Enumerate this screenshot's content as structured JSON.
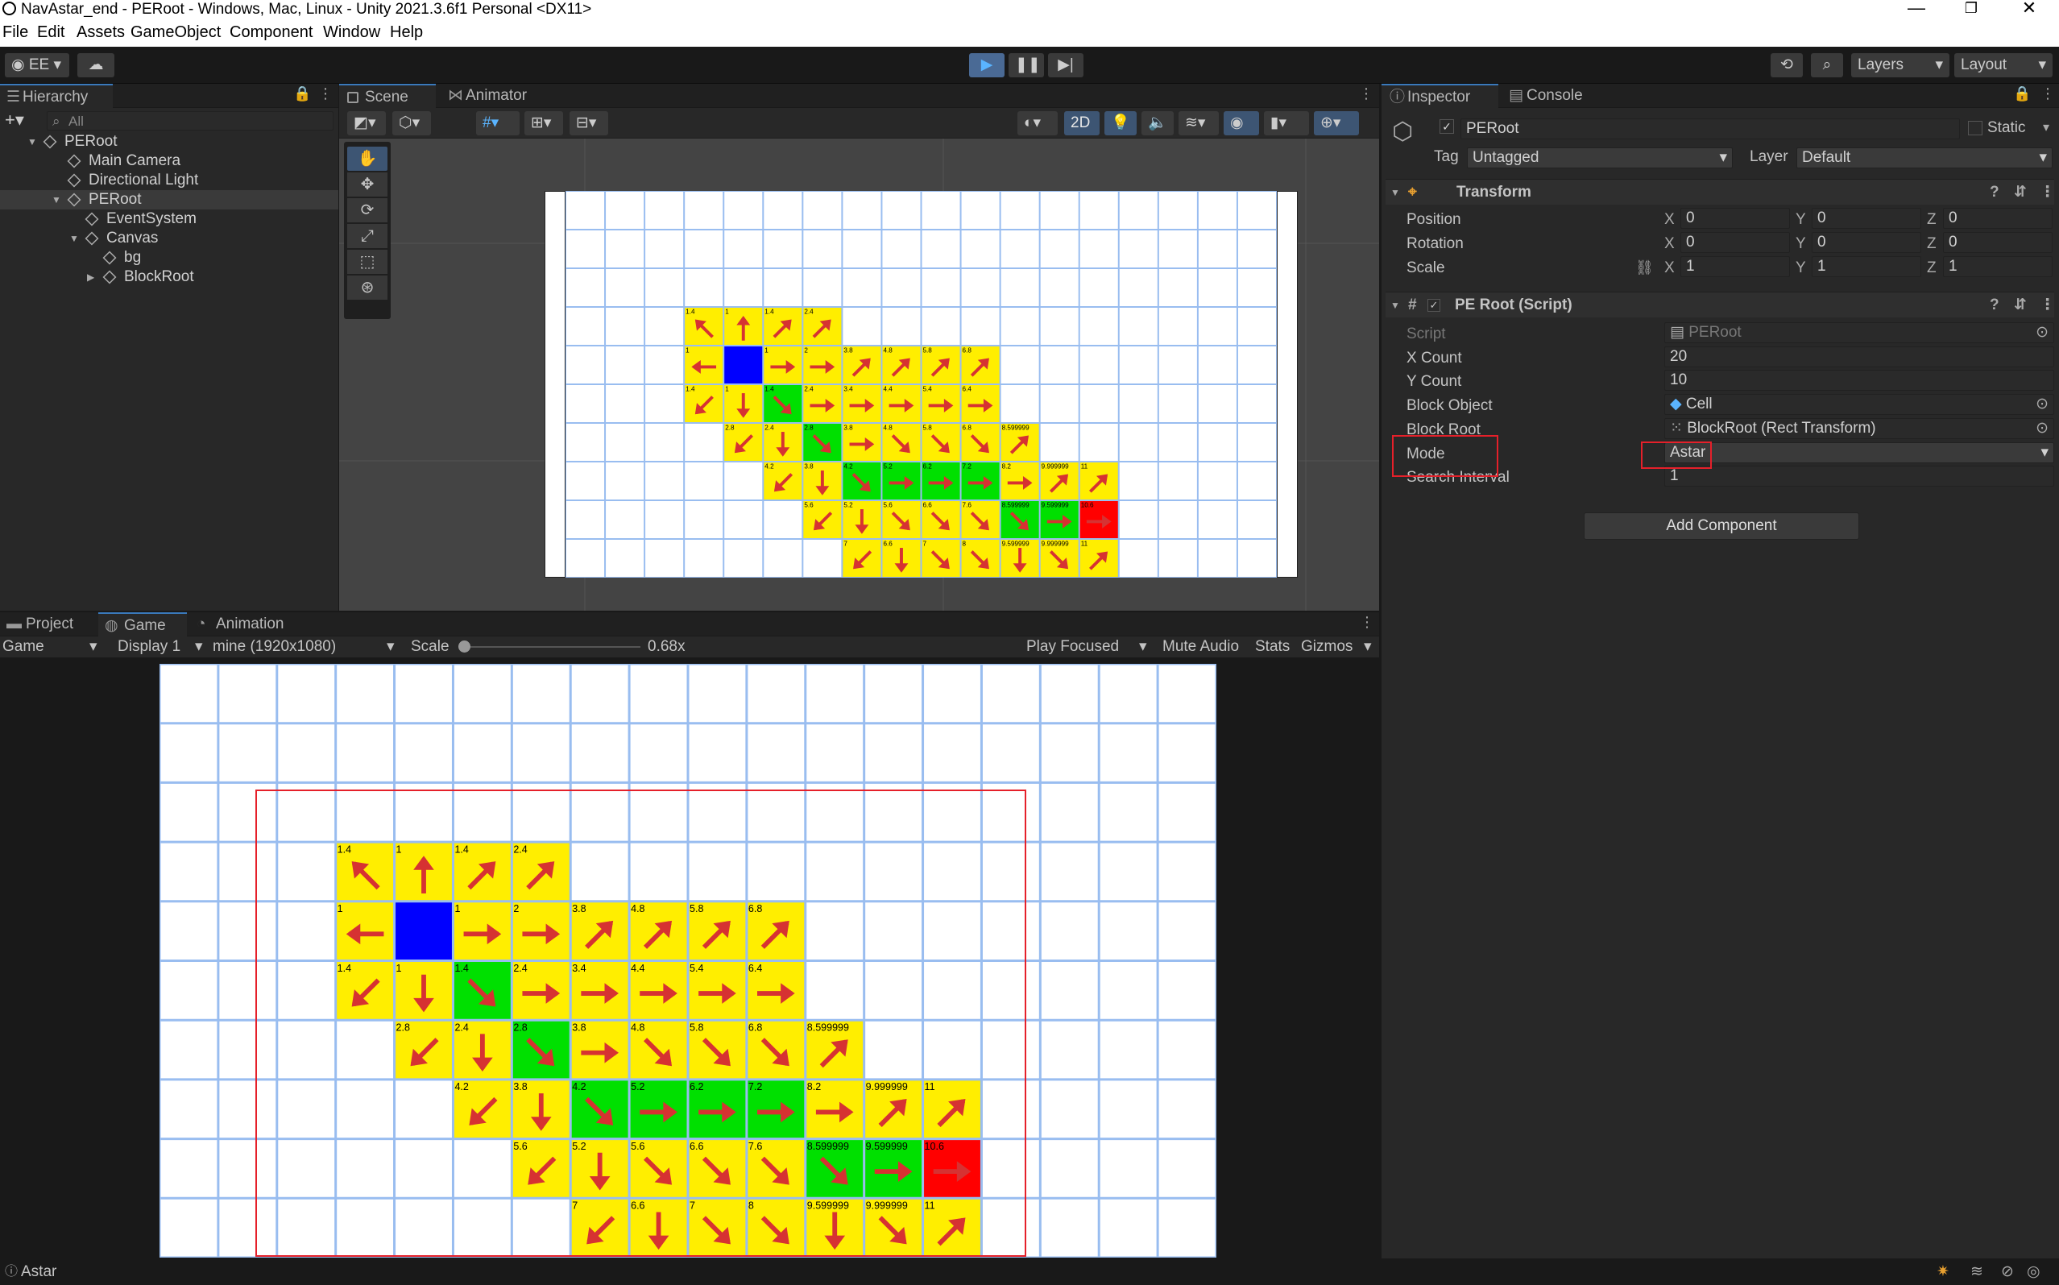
{
  "window": {
    "title": "NavAstar_end - PERoot - Windows, Mac, Linux - Unity 2021.3.6f1 Personal <DX11>",
    "minimize": "—",
    "maximize": "❐",
    "close": "✕"
  },
  "menu": [
    "File",
    "Edit",
    "Assets",
    "GameObject",
    "Component",
    "Window",
    "Help"
  ],
  "toolbar": {
    "account": "EE",
    "layers": "Layers",
    "layout": "Layout"
  },
  "hierarchy": {
    "tab": "Hierarchy",
    "search_placeholder": "All",
    "items": [
      {
        "label": "PERoot",
        "depth": 0
      },
      {
        "label": "Main Camera",
        "depth": 1
      },
      {
        "label": "Directional Light",
        "depth": 1
      },
      {
        "label": "PERoot",
        "depth": 1
      },
      {
        "label": "EventSystem",
        "depth": 2
      },
      {
        "label": "Canvas",
        "depth": 2
      },
      {
        "label": "bg",
        "depth": 3
      },
      {
        "label": "BlockRoot",
        "depth": 3
      }
    ]
  },
  "scene": {
    "tabs": [
      "Scene",
      "Animator"
    ],
    "mode2d": "2D"
  },
  "game": {
    "tabs": [
      "Project",
      "Game",
      "Animation"
    ],
    "display_mode": "Game",
    "display": "Display 1",
    "resolution": "mine (1920x1080)",
    "scale_label": "Scale",
    "scale_value": "0.68x",
    "play_focused": "Play Focused",
    "mute": "Mute Audio",
    "stats": "Stats",
    "gizmos": "Gizmos"
  },
  "inspector": {
    "tabs": [
      "Inspector",
      "Console"
    ],
    "object_name": "PERoot",
    "static_label": "Static",
    "tag_label": "Tag",
    "tag_value": "Untagged",
    "layer_label": "Layer",
    "layer_value": "Default",
    "transform": {
      "title": "Transform",
      "rows": [
        {
          "label": "Position",
          "x": "0",
          "y": "0",
          "z": "0"
        },
        {
          "label": "Rotation",
          "x": "0",
          "y": "0",
          "z": "0"
        },
        {
          "label": "Scale",
          "x": "1",
          "y": "1",
          "z": "1"
        }
      ]
    },
    "script": {
      "title": "PE Root (Script)",
      "fields": [
        {
          "label": "Script",
          "value": "PERoot"
        },
        {
          "label": "X Count",
          "value": "20"
        },
        {
          "label": "Y Count",
          "value": "10"
        },
        {
          "label": "Block Object",
          "value": "Cell"
        },
        {
          "label": "Block Root",
          "value": "BlockRoot (Rect Transform)"
        },
        {
          "label": "Mode",
          "value": "Astar"
        },
        {
          "label": "Search Interval",
          "value": "1"
        }
      ]
    },
    "add_component": "Add Component"
  },
  "status": {
    "text": "Astar"
  },
  "grid": {
    "cols": 18,
    "rows": 10,
    "cells": [
      {
        "r": 3,
        "c": 3,
        "t": "y",
        "v": "1.4",
        "a": "nw"
      },
      {
        "r": 3,
        "c": 4,
        "t": "y",
        "v": "1",
        "a": "n"
      },
      {
        "r": 3,
        "c": 5,
        "t": "y",
        "v": "1.4",
        "a": "ne"
      },
      {
        "r": 3,
        "c": 6,
        "t": "y",
        "v": "2.4",
        "a": "ne"
      },
      {
        "r": 4,
        "c": 3,
        "t": "y",
        "v": "1",
        "a": "w"
      },
      {
        "r": 4,
        "c": 4,
        "t": "b",
        "v": "",
        "a": ""
      },
      {
        "r": 4,
        "c": 5,
        "t": "y",
        "v": "1",
        "a": "e"
      },
      {
        "r": 4,
        "c": 6,
        "t": "y",
        "v": "2",
        "a": "e"
      },
      {
        "r": 4,
        "c": 7,
        "t": "y",
        "v": "3.8",
        "a": "ne"
      },
      {
        "r": 4,
        "c": 8,
        "t": "y",
        "v": "4.8",
        "a": "ne"
      },
      {
        "r": 4,
        "c": 9,
        "t": "y",
        "v": "5.8",
        "a": "ne"
      },
      {
        "r": 4,
        "c": 10,
        "t": "y",
        "v": "6.8",
        "a": "ne"
      },
      {
        "r": 5,
        "c": 3,
        "t": "y",
        "v": "1.4",
        "a": "sw"
      },
      {
        "r": 5,
        "c": 4,
        "t": "y",
        "v": "1",
        "a": "s"
      },
      {
        "r": 5,
        "c": 5,
        "t": "g",
        "v": "1.4",
        "a": "se"
      },
      {
        "r": 5,
        "c": 6,
        "t": "y",
        "v": "2.4",
        "a": "e"
      },
      {
        "r": 5,
        "c": 7,
        "t": "y",
        "v": "3.4",
        "a": "e"
      },
      {
        "r": 5,
        "c": 8,
        "t": "y",
        "v": "4.4",
        "a": "e"
      },
      {
        "r": 5,
        "c": 9,
        "t": "y",
        "v": "5.4",
        "a": "e"
      },
      {
        "r": 5,
        "c": 10,
        "t": "y",
        "v": "6.4",
        "a": "e"
      },
      {
        "r": 6,
        "c": 4,
        "t": "y",
        "v": "2.8",
        "a": "sw"
      },
      {
        "r": 6,
        "c": 5,
        "t": "y",
        "v": "2.4",
        "a": "s"
      },
      {
        "r": 6,
        "c": 6,
        "t": "g",
        "v": "2.8",
        "a": "se"
      },
      {
        "r": 6,
        "c": 7,
        "t": "y",
        "v": "3.8",
        "a": "e"
      },
      {
        "r": 6,
        "c": 8,
        "t": "y",
        "v": "4.8",
        "a": "se"
      },
      {
        "r": 6,
        "c": 9,
        "t": "y",
        "v": "5.8",
        "a": "se"
      },
      {
        "r": 6,
        "c": 10,
        "t": "y",
        "v": "6.8",
        "a": "se"
      },
      {
        "r": 6,
        "c": 11,
        "t": "y",
        "v": "8.599999",
        "a": "ne"
      },
      {
        "r": 7,
        "c": 5,
        "t": "y",
        "v": "4.2",
        "a": "sw"
      },
      {
        "r": 7,
        "c": 6,
        "t": "y",
        "v": "3.8",
        "a": "s"
      },
      {
        "r": 7,
        "c": 7,
        "t": "g",
        "v": "4.2",
        "a": "se"
      },
      {
        "r": 7,
        "c": 8,
        "t": "g",
        "v": "5.2",
        "a": "e"
      },
      {
        "r": 7,
        "c": 9,
        "t": "g",
        "v": "6.2",
        "a": "e"
      },
      {
        "r": 7,
        "c": 10,
        "t": "g",
        "v": "7.2",
        "a": "e"
      },
      {
        "r": 7,
        "c": 11,
        "t": "y",
        "v": "8.2",
        "a": "e"
      },
      {
        "r": 7,
        "c": 12,
        "t": "y",
        "v": "9.999999",
        "a": "ne"
      },
      {
        "r": 7,
        "c": 13,
        "t": "y",
        "v": "11",
        "a": "ne"
      },
      {
        "r": 8,
        "c": 6,
        "t": "y",
        "v": "5.6",
        "a": "sw"
      },
      {
        "r": 8,
        "c": 7,
        "t": "y",
        "v": "5.2",
        "a": "s"
      },
      {
        "r": 8,
        "c": 8,
        "t": "y",
        "v": "5.6",
        "a": "se"
      },
      {
        "r": 8,
        "c": 9,
        "t": "y",
        "v": "6.6",
        "a": "se"
      },
      {
        "r": 8,
        "c": 10,
        "t": "y",
        "v": "7.6",
        "a": "se"
      },
      {
        "r": 8,
        "c": 11,
        "t": "g",
        "v": "8.599999",
        "a": "se"
      },
      {
        "r": 8,
        "c": 12,
        "t": "g",
        "v": "9.599999",
        "a": "e"
      },
      {
        "r": 8,
        "c": 13,
        "t": "r",
        "v": "10.6",
        "a": "e"
      },
      {
        "r": 9,
        "c": 7,
        "t": "y",
        "v": "7",
        "a": "sw"
      },
      {
        "r": 9,
        "c": 8,
        "t": "y",
        "v": "6.6",
        "a": "s"
      },
      {
        "r": 9,
        "c": 9,
        "t": "y",
        "v": "7",
        "a": "se"
      },
      {
        "r": 9,
        "c": 10,
        "t": "y",
        "v": "8",
        "a": "se"
      },
      {
        "r": 9,
        "c": 11,
        "t": "y",
        "v": "9.599999",
        "a": "s"
      },
      {
        "r": 9,
        "c": 12,
        "t": "y",
        "v": "9.999999",
        "a": "se"
      },
      {
        "r": 9,
        "c": 13,
        "t": "y",
        "v": "11",
        "a": "ne"
      }
    ]
  },
  "colors": {
    "yellow": "#ffee00",
    "green": "#00e000",
    "blue": "#0000ff",
    "red": "#ff0000",
    "arrow": "#d63232",
    "gridline": "#99bdf0",
    "accent": "#3a79bb",
    "highlight": "#e5202a"
  }
}
